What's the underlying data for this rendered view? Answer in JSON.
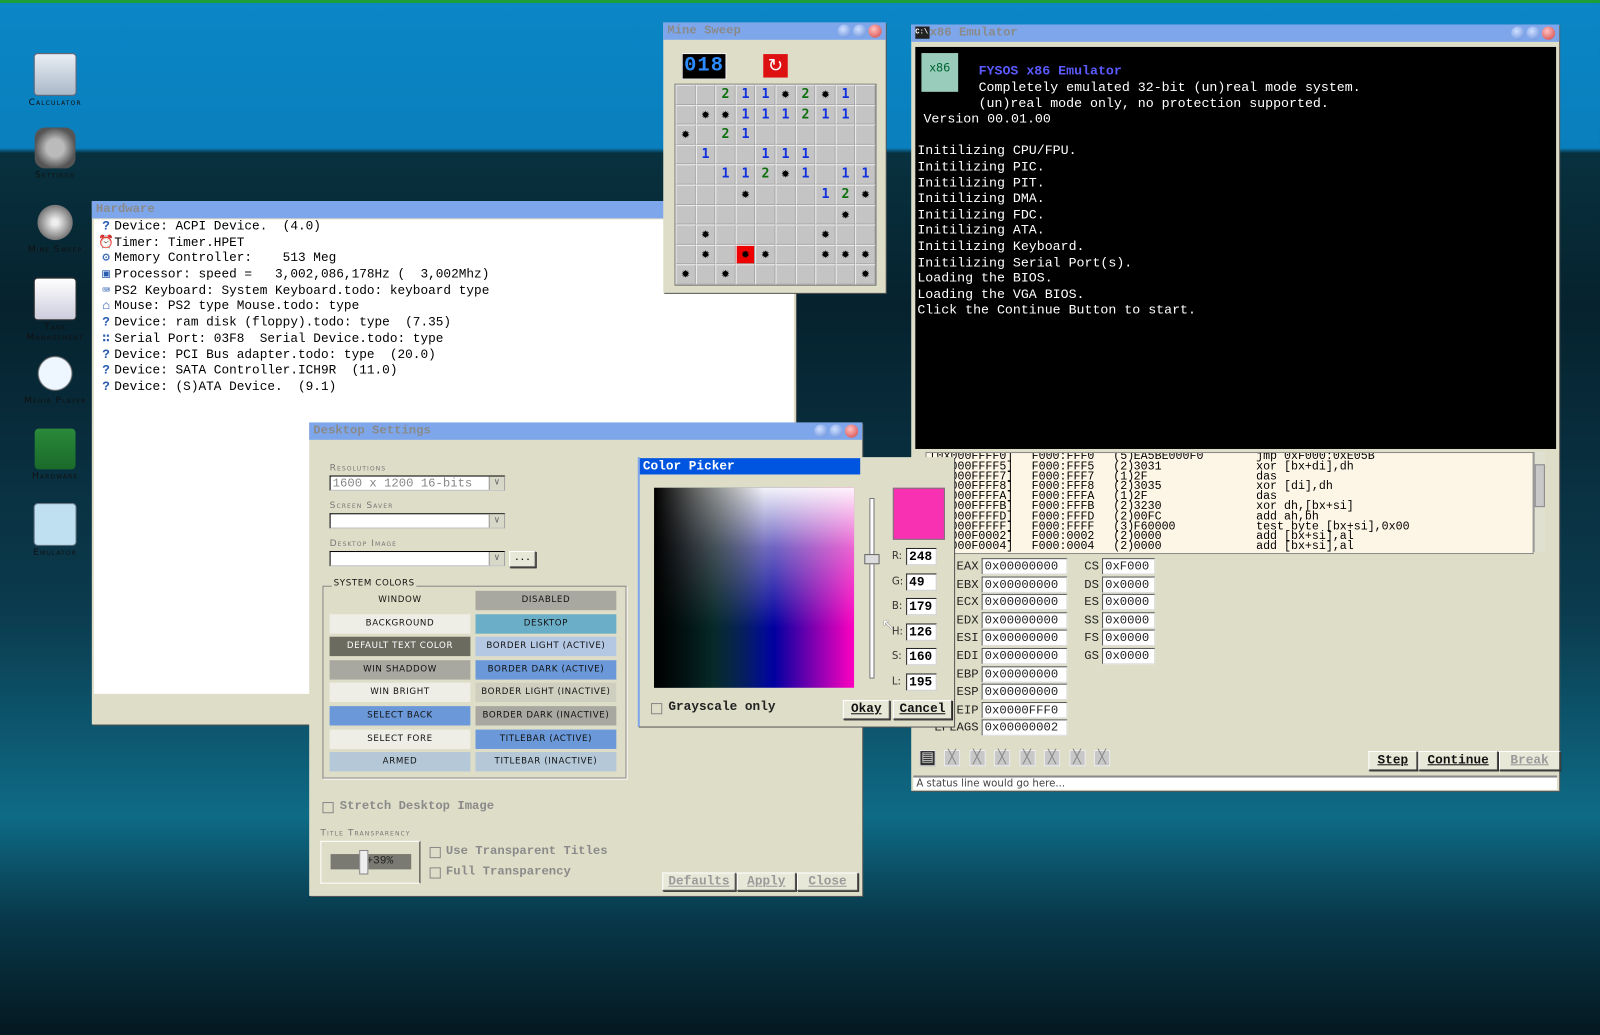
{
  "desktop_icons": [
    {
      "label": "Calculator",
      "icon": "calculator-icon"
    },
    {
      "label": "Settings",
      "icon": "gear-icon"
    },
    {
      "label": "Mine Sweep",
      "icon": "mine-icon"
    },
    {
      "label": "Task Management",
      "icon": "clipboard-icon"
    },
    {
      "label": "Media Player",
      "icon": "play-icon"
    },
    {
      "label": "Hardware",
      "icon": "circuit-board-icon"
    },
    {
      "label": "Emulator",
      "icon": "x86-emu-icon"
    }
  ],
  "hardware": {
    "title": "Hardware",
    "items": [
      {
        "icon": "question-icon",
        "text": "Device: ACPI Device.  (4.0)"
      },
      {
        "icon": "alarm-clock-icon",
        "text": "Timer: Timer.HPET"
      },
      {
        "icon": "memory-chip-icon",
        "text": "Memory Controller:    513 Meg"
      },
      {
        "icon": "processor-icon",
        "text": "Processor: speed =   3,002,086,178Hz (  3,002Mhz)"
      },
      {
        "icon": "keyboard-icon",
        "text": "PS2 Keyboard: System Keyboard.todo: keyboard type"
      },
      {
        "icon": "mouse-icon",
        "text": "Mouse: PS2 type Mouse.todo: type"
      },
      {
        "icon": "question-icon",
        "text": "Device: ram disk (floppy).todo: type  (7.35)"
      },
      {
        "icon": "serial-port-icon",
        "text": "Serial Port: 03F8  Serial Device.todo: type"
      },
      {
        "icon": "question-icon",
        "text": "Device: PCI Bus adapter.todo: type  (20.0)"
      },
      {
        "icon": "question-icon",
        "text": "Device: SATA Controller.ICH9R  (11.0)"
      },
      {
        "icon": "question-icon",
        "text": "Device: (S)ATA Device.  (9.1)"
      }
    ]
  },
  "minesweep": {
    "title": "Mine Sweep",
    "counter": "018",
    "grid": [
      "..211*2*1.",
      ".**111211.",
      "*.21......",
      ".1..111...",
      "..112*1.11",
      "...*...12*",
      "........*.",
      ".*.....*..",
      ".*.R*..***",
      "*.*......*"
    ]
  },
  "emulator": {
    "title": "x86 Emulator",
    "console": {
      "heading": "FYSOS x86 Emulator",
      "lines": [
        "Completely emulated 32-bit (un)real mode system.",
        "(un)real mode only, no protection supported.",
        "Version 00.01.00",
        "",
        "Initilizing CPU/FPU.",
        "Initilizing PIC.",
        "Initilizing PIT.",
        "Initilizing DMA.",
        "Initilizing FDC.",
        "Initilizing ATA.",
        "Initilizing Keyboard.",
        "Initilizing Serial Port(s).",
        "Loading the BIOS.",
        "Loading the VGA BIOS.",
        "Click the Continue Button to start."
      ]
    },
    "disassembly": [
      {
        "addr": "[0x000FFFF0]",
        "seg": "F000:FFF0",
        "len": "(5)",
        "bytes": "EA5BE000F0",
        "instr": "jmp 0xF000:0xE05B"
      },
      {
        "addr": "[0x000FFFF5]",
        "seg": "F000:FFF5",
        "len": "(2)",
        "bytes": "3031",
        "instr": "xor [bx+di],dh"
      },
      {
        "addr": "[0x000FFFF7]",
        "seg": "F000:FFF7",
        "len": "(1)",
        "bytes": "2F",
        "instr": "das"
      },
      {
        "addr": "[0x000FFFF8]",
        "seg": "F000:FFF8",
        "len": "(2)",
        "bytes": "3035",
        "instr": "xor [di],dh"
      },
      {
        "addr": "[0x000FFFFA]",
        "seg": "F000:FFFA",
        "len": "(1)",
        "bytes": "2F",
        "instr": "das"
      },
      {
        "addr": "[0x000FFFFB]",
        "seg": "F000:FFFB",
        "len": "(2)",
        "bytes": "3230",
        "instr": "xor dh,[bx+si]"
      },
      {
        "addr": "[0x000FFFFD]",
        "seg": "F000:FFFD",
        "len": "(2)",
        "bytes": "00FC",
        "instr": "add ah,bh"
      },
      {
        "addr": "[0x000FFFFF]",
        "seg": "F000:FFFF",
        "len": "(3)",
        "bytes": "F60000",
        "instr": "test byte [bx+si],0x00"
      },
      {
        "addr": "[0x000F0002]",
        "seg": "F000:0002",
        "len": "(2)",
        "bytes": "0000",
        "instr": "add [bx+si],al"
      },
      {
        "addr": "[0x000F0004]",
        "seg": "F000:0004",
        "len": "(2)",
        "bytes": "0000",
        "instr": "add [bx+si],al"
      }
    ],
    "registers": [
      {
        "name": "EAX",
        "value": "0x00000000"
      },
      {
        "name": "EBX",
        "value": "0x00000000"
      },
      {
        "name": "ECX",
        "value": "0x00000000"
      },
      {
        "name": "EDX",
        "value": "0x00000000"
      },
      {
        "name": "ESI",
        "value": "0x00000000"
      },
      {
        "name": "EDI",
        "value": "0x00000000"
      },
      {
        "name": "EBP",
        "value": "0x00000000"
      },
      {
        "name": "ESP",
        "value": "0x00000000"
      },
      {
        "name": "EIP",
        "value": "0x0000FFF0"
      },
      {
        "name": "EFLAGS",
        "value": "0x00000002"
      }
    ],
    "segments": [
      {
        "name": "CS",
        "value": "0xF000"
      },
      {
        "name": "DS",
        "value": "0x0000"
      },
      {
        "name": "ES",
        "value": "0x0000"
      },
      {
        "name": "SS",
        "value": "0x0000"
      },
      {
        "name": "FS",
        "value": "0x0000"
      },
      {
        "name": "GS",
        "value": "0x0000"
      }
    ],
    "buttons": {
      "step": "Step",
      "continue": "Continue",
      "break": "Break"
    },
    "status": "A status line would go here..."
  },
  "settings": {
    "title": "Desktop Settings",
    "resolutions_label": "Resolutions",
    "resolution_value": "1600 x 1200 16-bits",
    "screen_saver_label": "Screen Saver",
    "screen_saver_value": "",
    "desktop_image_label": "Desktop Image",
    "desktop_image_value": "",
    "browse_label": "...",
    "system_colors_label": "SYSTEM COLORS",
    "colors": [
      {
        "label": "Window",
        "color": "#dedec8",
        "text": "#111"
      },
      {
        "label": "Disabled",
        "color": "#a8a8a0",
        "text": "#111"
      },
      {
        "label": "Background",
        "color": "#eeeee6",
        "text": "#111"
      },
      {
        "label": "Desktop",
        "color": "#6aaec8",
        "text": "#111"
      },
      {
        "label": "Default Text Color",
        "color": "#6b6b60",
        "text": "#fff"
      },
      {
        "label": "Border Light (Active)",
        "color": "#b4c8e4",
        "text": "#111"
      },
      {
        "label": "Win Shaddow",
        "color": "#a8a8a0",
        "text": "#111"
      },
      {
        "label": "Border Dark (Active)",
        "color": "#6a98d8",
        "text": "#111"
      },
      {
        "label": "Win Bright",
        "color": "#eeeee6",
        "text": "#111"
      },
      {
        "label": "Border Light (Inactive)",
        "color": "#cfcfc0",
        "text": "#111"
      },
      {
        "label": "Select Back",
        "color": "#6a98d8",
        "text": "#111"
      },
      {
        "label": "Border Dark (Inactive)",
        "color": "#a8a8a0",
        "text": "#111"
      },
      {
        "label": "Select Fore",
        "color": "#eeeee6",
        "text": "#111"
      },
      {
        "label": "Titlebar (Active)",
        "color": "#6a98d8",
        "text": "#111"
      },
      {
        "label": "Armed",
        "color": "#b4c8d8",
        "text": "#111"
      },
      {
        "label": "Titlebar (Inactive)",
        "color": "#b4c8d8",
        "text": "#111"
      }
    ],
    "stretch_label": "Stretch Desktop Image",
    "stretch_checked": false,
    "transparency_label": "Title Transparency",
    "transparency_value": "+39%",
    "transparency_percent": 39,
    "use_transparent_label": "Use Transparent Titles",
    "full_transparency_label": "Full Transparency",
    "buttons": {
      "defaults": "Defaults",
      "apply": "Apply",
      "close": "Close"
    }
  },
  "color_picker": {
    "title": "Color Picker",
    "selected_color": "#f831b3",
    "fields": [
      {
        "label": "R:",
        "value": "248"
      },
      {
        "label": "G:",
        "value": "49"
      },
      {
        "label": "B:",
        "value": "179"
      },
      {
        "label": "H:",
        "value": "126"
      },
      {
        "label": "S:",
        "value": "160"
      },
      {
        "label": "L:",
        "value": "195"
      }
    ],
    "grayscale_label": "Grayscale only",
    "grayscale_checked": false,
    "okay": "Okay",
    "cancel": "Cancel"
  }
}
